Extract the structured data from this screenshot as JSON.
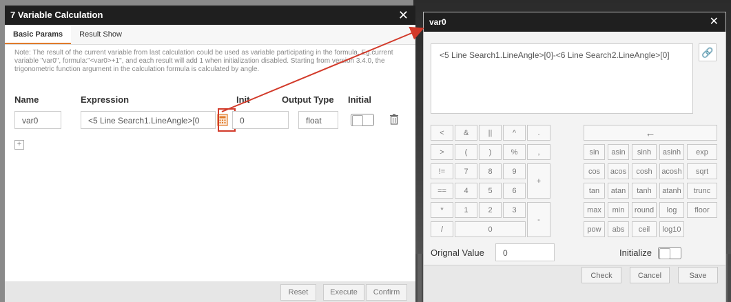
{
  "left_dialog": {
    "title": "7 Variable Calculation",
    "close": "✕",
    "tabs": [
      "Basic Params",
      "Result Show"
    ],
    "note": "Note: The result of the current variable from last calculation could be used as variable participating in the formula. Eg.current variable \"var0\", formula:\"<var0>+1\", and each result will add 1 when initialization disabled. Starting from version 3.4.0, the trigonometric function argument in the calculation formula is calculated by angle.",
    "columns": [
      "Name",
      "Expression",
      "Init",
      "Output Type",
      "Initial"
    ],
    "row": {
      "name": "var0",
      "expression": "<5 Line Search1.LineAngle>[0",
      "init": "0",
      "output_type": "float"
    },
    "add": "+",
    "footer": [
      "Reset",
      "Execute",
      "Confirm"
    ]
  },
  "right_dialog": {
    "title": "var0",
    "close": "✕",
    "expression": "<5 Line Search1.LineAngle>[0]-<6 Line Search2.LineAngle>[0]",
    "backspace": "←",
    "keys": [
      {
        "k": "<"
      },
      {
        "k": "&"
      },
      {
        "k": "||"
      },
      {
        "k": "^"
      },
      {
        "k": "."
      },
      {
        "k": ">"
      },
      {
        "k": "("
      },
      {
        "k": ")"
      },
      {
        "k": "%"
      },
      {
        "k": ","
      },
      {
        "k": "!="
      },
      {
        "k": "7"
      },
      {
        "k": "8"
      },
      {
        "k": "9"
      },
      {
        "k": "+"
      },
      {
        "k": "=="
      },
      {
        "k": "4"
      },
      {
        "k": "5"
      },
      {
        "k": "6"
      },
      {
        "k": "*"
      },
      {
        "k": "1"
      },
      {
        "k": "2"
      },
      {
        "k": "3"
      },
      {
        "k": "-"
      },
      {
        "k": "/"
      },
      {
        "k": "0"
      }
    ],
    "funcs": [
      "sin",
      "asin",
      "sinh",
      "asinh",
      "exp",
      "cos",
      "acos",
      "cosh",
      "acosh",
      "sqrt",
      "tan",
      "atan",
      "tanh",
      "atanh",
      "trunc",
      "max",
      "min",
      "round",
      "log",
      "floor",
      "pow",
      "abs",
      "ceil",
      "log10"
    ],
    "original_label": "Orignal Value",
    "original_value": "0",
    "initialize_label": "Initialize",
    "footer": [
      "Check",
      "Cancel",
      "Save"
    ]
  },
  "colors": {
    "accent": "#e07b2a",
    "highlight": "#d23a2a",
    "titlebar": "#1f1f1f"
  }
}
